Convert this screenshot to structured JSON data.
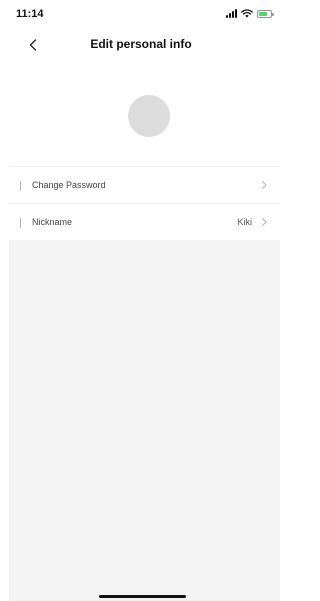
{
  "status_bar": {
    "time": "11:14",
    "icons": [
      "signal-icon",
      "wifi-icon",
      "battery-icon"
    ],
    "battery_color": "#4cd964"
  },
  "header": {
    "title": "Edit personal info",
    "back_icon": "chevron-left-icon"
  },
  "avatar": {
    "color": "#dcdcdc"
  },
  "rows": [
    {
      "label": "Change Password",
      "value": "",
      "icon": "chevron-right-icon"
    },
    {
      "label": "Nickname",
      "value": "Kiki",
      "icon": "chevron-right-icon"
    }
  ]
}
